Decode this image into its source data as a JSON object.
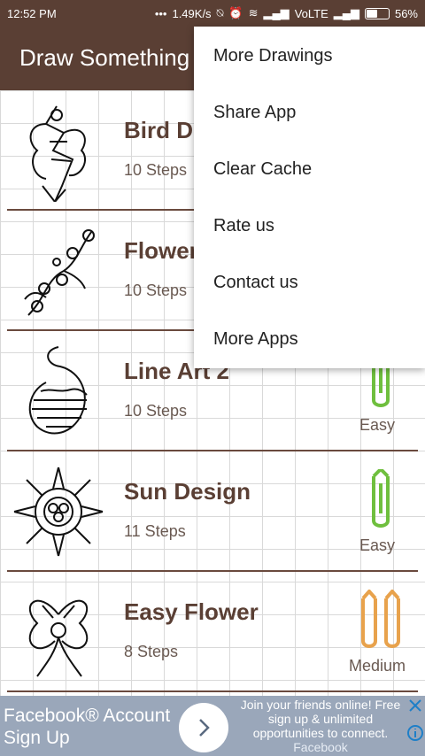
{
  "status": {
    "time": "12:52 PM",
    "speed": "1.49K/s",
    "network": "VoLTE",
    "battery": "56%",
    "battery_level": 0.56
  },
  "app": {
    "title": "Draw Something"
  },
  "menu": {
    "items": [
      "More Drawings",
      "Share App",
      "Clear Cache",
      "Rate us",
      "Contact us",
      "More Apps"
    ]
  },
  "rows": [
    {
      "name": "Bird Des",
      "steps": "10 Steps",
      "difficulty": ""
    },
    {
      "name": "Flower V",
      "steps": "10 Steps",
      "difficulty": ""
    },
    {
      "name": "Line Art 2",
      "steps": "10 Steps",
      "difficulty": "Easy"
    },
    {
      "name": "Sun Design",
      "steps": "11 Steps",
      "difficulty": "Easy"
    },
    {
      "name": "Easy Flower",
      "steps": "8 Steps",
      "difficulty": "Medium"
    }
  ],
  "colors": {
    "bar": "#5a3f34",
    "easy_pencil": "#6fbf3e",
    "medium_pencil": "#e8a24c",
    "ad_bg": "#9aa7ba"
  },
  "ad": {
    "left_text": "Facebook® Account Sign Up",
    "right_text": "Join your friends online! Free sign up & unlimited opportunities to connect.",
    "brand": "Facebook"
  }
}
